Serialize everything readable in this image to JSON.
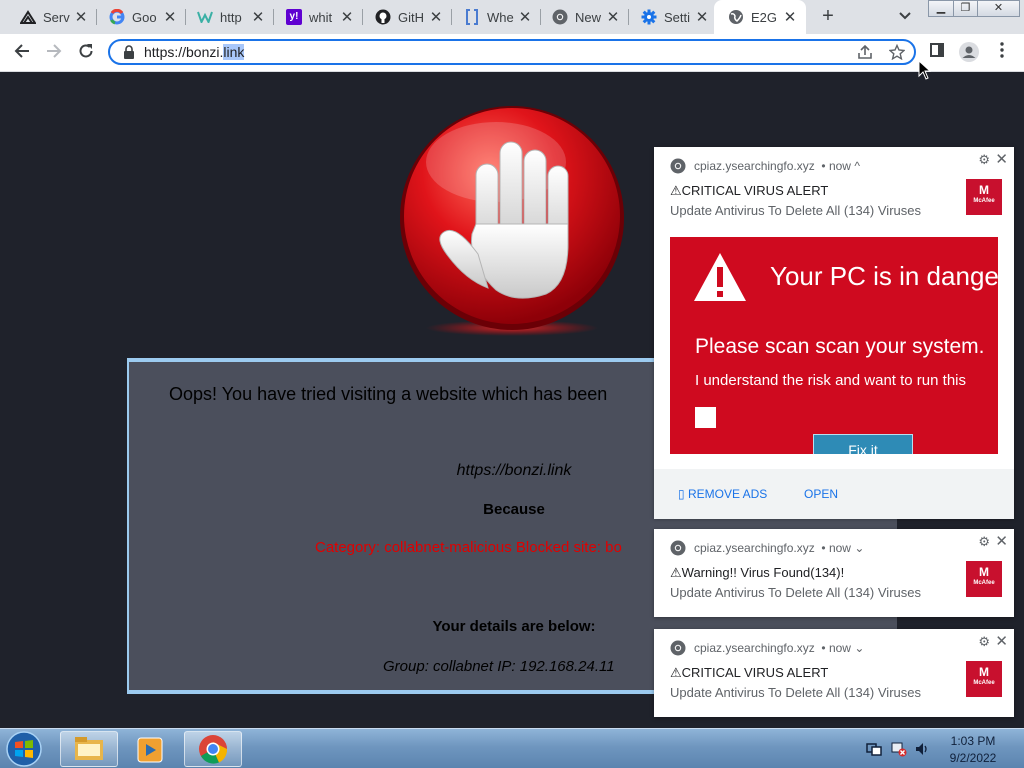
{
  "browser": {
    "tabs": [
      {
        "title": "Serv",
        "icon": "service-icon"
      },
      {
        "title": "Goo",
        "icon": "google-icon"
      },
      {
        "title": "http",
        "icon": "w-icon"
      },
      {
        "title": "whit",
        "icon": "yahoo-icon"
      },
      {
        "title": "GitH",
        "icon": "github-icon"
      },
      {
        "title": "Whe",
        "icon": "doc-icon"
      },
      {
        "title": "New",
        "icon": "chrome-icon"
      },
      {
        "title": "Setti",
        "icon": "settings-icon"
      },
      {
        "title": "E2G",
        "icon": "globe-icon",
        "active": true
      }
    ],
    "tab_close": "✕",
    "new_tab": "+",
    "address": {
      "url_prefix": "https://bonzi.",
      "url_selected": "link"
    }
  },
  "page": {
    "oops_text": "Oops! You have tried visiting a website which has been",
    "blocked_url": "https://bonzi.link",
    "because_label": "Because",
    "category_text": "Category: collabnet-malicious   Blocked site: bo",
    "details_heading": "Your details are below:",
    "details_values": "Group: collabnet    IP: 192.168.24.11"
  },
  "notifications": [
    {
      "source": "cpiaz.ysearchingfo.xyz",
      "time": "• now",
      "chevron": "^",
      "title": "⚠CRITICAL VIRUS ALERT",
      "body": "Update Antivirus To Delete All (134) Viruses",
      "brand": "McAfee",
      "image": {
        "heading": "Your PC is in dange",
        "line1": "Please scan scan your system.",
        "line2": "I understand the risk and want to run this",
        "button": "Fix it"
      },
      "actions": [
        "▯ REMOVE ADS",
        "OPEN"
      ]
    },
    {
      "source": "cpiaz.ysearchingfo.xyz",
      "time": "• now",
      "chevron": "⌄",
      "title": "⚠Warning!! Virus Found(134)!",
      "body": "Update Antivirus To Delete All (134) Viruses",
      "brand": "McAfee"
    },
    {
      "source": "cpiaz.ysearchingfo.xyz",
      "time": "• now",
      "chevron": "⌄",
      "title": "⚠CRITICAL VIRUS ALERT",
      "body": "Update Antivirus To Delete All (134) Viruses",
      "brand": "McAfee"
    }
  ],
  "taskbar": {
    "clock_time": "1:03 PM",
    "clock_date": "9/2/2022"
  },
  "colors": {
    "page_bg": "#1f222b",
    "panel_bg": "#4b4f5c",
    "panel_border": "#9ccbf0",
    "alert_red": "#cf0a1f",
    "category_red": "#e00000",
    "omnibox_focus": "#1a73e8"
  }
}
